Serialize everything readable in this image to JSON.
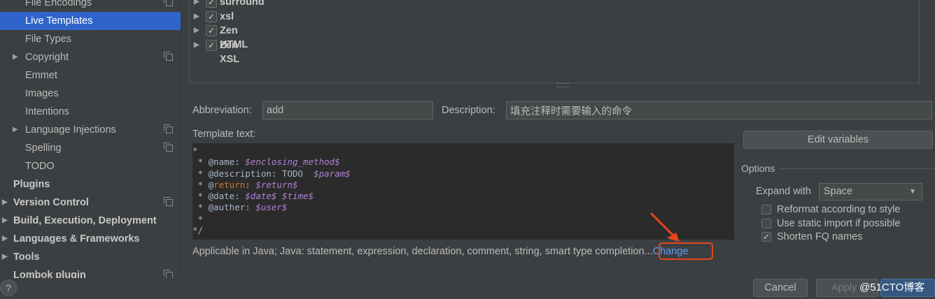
{
  "sidebar": {
    "items": [
      {
        "label": "File Encodings",
        "indent": "child",
        "arrow": false,
        "copy": true,
        "selected": false,
        "bold": false
      },
      {
        "label": "Live Templates",
        "indent": "child",
        "arrow": false,
        "copy": false,
        "selected": true,
        "bold": false
      },
      {
        "label": "File Types",
        "indent": "child",
        "arrow": false,
        "copy": false,
        "selected": false,
        "bold": false
      },
      {
        "label": "Copyright",
        "indent": "child",
        "arrow": true,
        "copy": true,
        "selected": false,
        "bold": false
      },
      {
        "label": "Emmet",
        "indent": "child",
        "arrow": false,
        "copy": false,
        "selected": false,
        "bold": false
      },
      {
        "label": "Images",
        "indent": "child",
        "arrow": false,
        "copy": false,
        "selected": false,
        "bold": false
      },
      {
        "label": "Intentions",
        "indent": "child",
        "arrow": false,
        "copy": false,
        "selected": false,
        "bold": false
      },
      {
        "label": "Language Injections",
        "indent": "child",
        "arrow": true,
        "copy": true,
        "selected": false,
        "bold": false
      },
      {
        "label": "Spelling",
        "indent": "child",
        "arrow": false,
        "copy": true,
        "selected": false,
        "bold": false
      },
      {
        "label": "TODO",
        "indent": "child",
        "arrow": false,
        "copy": false,
        "selected": false,
        "bold": false
      },
      {
        "label": "Plugins",
        "indent": "top",
        "arrow": false,
        "copy": false,
        "selected": false,
        "bold": true
      },
      {
        "label": "Version Control",
        "indent": "top",
        "arrow": true,
        "copy": true,
        "selected": false,
        "bold": true
      },
      {
        "label": "Build, Execution, Deployment",
        "indent": "top",
        "arrow": true,
        "copy": false,
        "selected": false,
        "bold": true
      },
      {
        "label": "Languages & Frameworks",
        "indent": "top",
        "arrow": true,
        "copy": false,
        "selected": false,
        "bold": true
      },
      {
        "label": "Tools",
        "indent": "top",
        "arrow": true,
        "copy": false,
        "selected": false,
        "bold": true
      },
      {
        "label": "Lombok plugin",
        "indent": "top",
        "arrow": false,
        "copy": true,
        "selected": false,
        "bold": true
      }
    ]
  },
  "tree": {
    "items": [
      {
        "label": "surround",
        "checked": true
      },
      {
        "label": "xsl",
        "checked": true
      },
      {
        "label": "Zen HTML",
        "checked": true
      },
      {
        "label": "Zen XSL",
        "checked": true
      }
    ]
  },
  "form": {
    "abbreviation_label": "Abbreviation:",
    "abbreviation_value": "add",
    "description_label": "Description:",
    "description_value": "填充注释时需要输入的命令",
    "template_text_label": "Template text:",
    "template_lines": [
      "*",
      " * @name: $enclosing_method$",
      " * @description: TODO  $param$",
      " * @return: $return$",
      " * @date: $date$ $time$",
      " * @auther: $user$",
      " *",
      "*/"
    ],
    "applicable_text": "Applicable in Java; Java: statement, expression, declaration, comment, string, smart type completion...",
    "change_link": "Change"
  },
  "options": {
    "edit_variables_label": "Edit variables",
    "title": "Options",
    "expand_with_label": "Expand with",
    "expand_with_value": "Space",
    "checkboxes": [
      {
        "label": "Reformat according to style",
        "checked": false
      },
      {
        "label": "Use static import if possible",
        "checked": false
      },
      {
        "label": "Shorten FQ names",
        "checked": true
      }
    ]
  },
  "bottom": {
    "help_label": "?",
    "cancel_label": "Cancel",
    "apply_label": "Apply",
    "watermark": "@51CTO博客"
  },
  "colors": {
    "selection": "#2f65ca",
    "link": "#589df6",
    "highlight_box": "#e8451e",
    "template_var": "#b07fd8",
    "keyword": "#cc7832"
  }
}
